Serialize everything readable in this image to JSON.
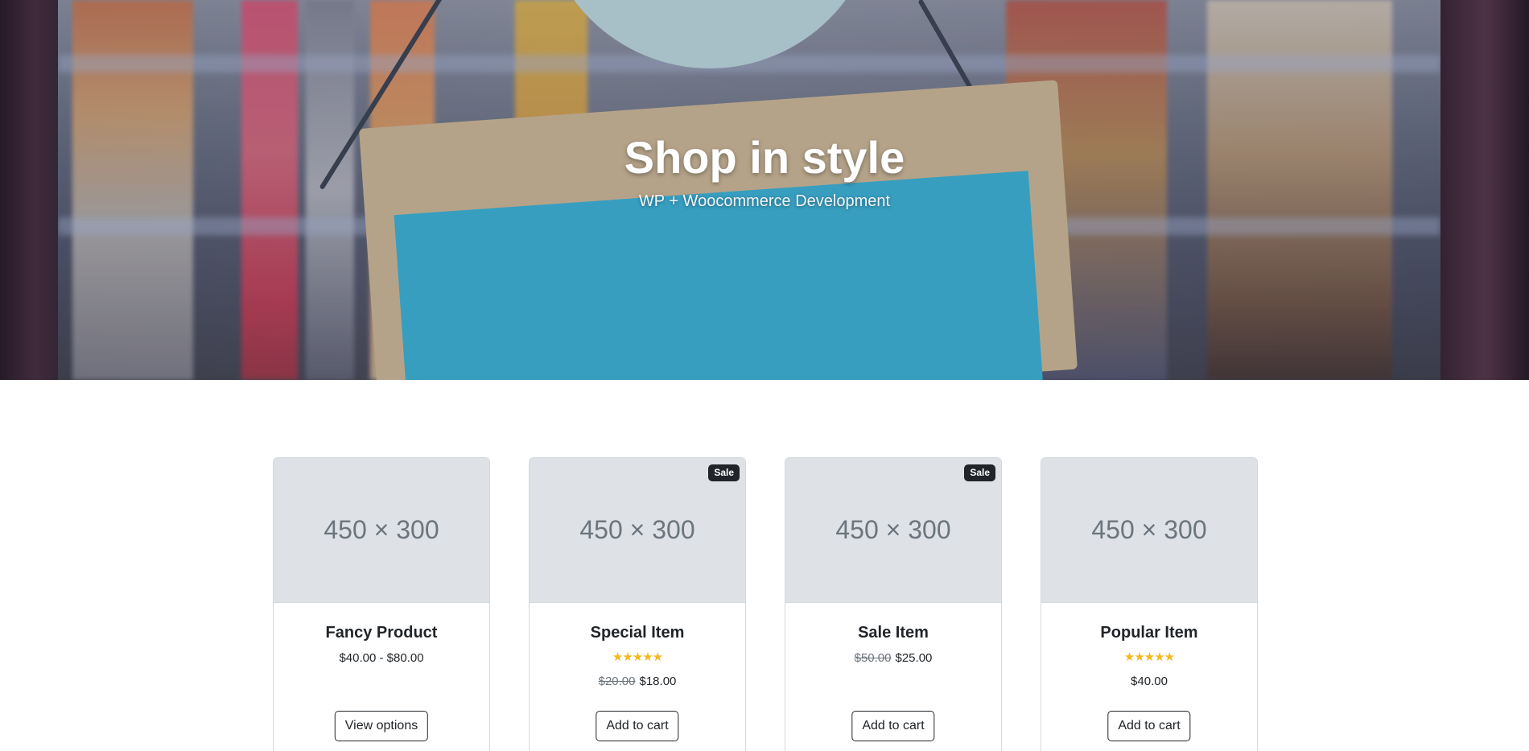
{
  "hero": {
    "title": "Shop in style",
    "subtitle": "WP + Woocommerce Development"
  },
  "products": [
    {
      "thumb_text": "450 × 300",
      "badge": "",
      "name": "Fancy Product",
      "rating": 0,
      "price_old": "",
      "price": "$40.00 - $80.00",
      "button_label": "View options"
    },
    {
      "thumb_text": "450 × 300",
      "badge": "Sale",
      "name": "Special Item",
      "rating": 5,
      "price_old": "$20.00",
      "price": "$18.00",
      "button_label": "Add to cart"
    },
    {
      "thumb_text": "450 × 300",
      "badge": "Sale",
      "name": "Sale Item",
      "rating": 0,
      "price_old": "$50.00",
      "price": "$25.00",
      "button_label": "Add to cart"
    },
    {
      "thumb_text": "450 × 300",
      "badge": "",
      "name": "Popular Item",
      "rating": 5,
      "price_old": "",
      "price": "$40.00",
      "button_label": "Add to cart"
    }
  ],
  "colors": {
    "star": "#f5b81c",
    "badge_bg": "#212529",
    "placeholder_bg": "#dee2e6"
  }
}
